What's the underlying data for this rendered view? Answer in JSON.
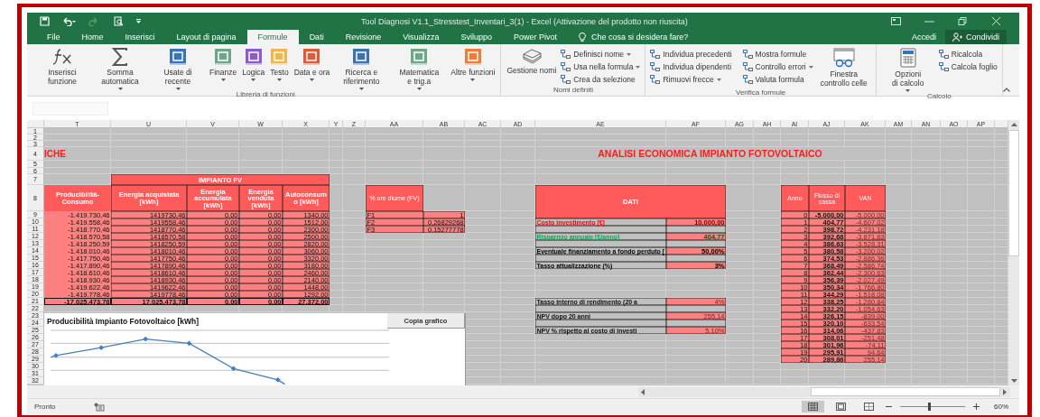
{
  "window": {
    "title": "Tool Diagnosi V1.1_Stresstest_Inventari_3(1) - Excel (Attivazione del prodotto non riuscita)"
  },
  "tabs": [
    {
      "label": "File",
      "selected": false
    },
    {
      "label": "Home",
      "selected": false
    },
    {
      "label": "Inserisci",
      "selected": false
    },
    {
      "label": "Layout di pagina",
      "selected": false
    },
    {
      "label": "Formule",
      "selected": true
    },
    {
      "label": "Dati",
      "selected": false
    },
    {
      "label": "Revisione",
      "selected": false
    },
    {
      "label": "Visualizza",
      "selected": false
    },
    {
      "label": "Sviluppo",
      "selected": false
    },
    {
      "label": "Power Pivot",
      "selected": false
    }
  ],
  "tell_me": {
    "placeholder": "Che cosa si desidera fare?"
  },
  "account": {
    "sign_in": "Accedi",
    "share": "Condividi"
  },
  "ribbon": {
    "groups": [
      {
        "label": "Libreria di funzioni",
        "items": [
          {
            "kind": "big",
            "label": "Inserisci funzione",
            "dropdown": false
          },
          {
            "kind": "big",
            "label": "Somma automatica",
            "dropdown": true
          },
          {
            "kind": "big",
            "label": "Usate di recente",
            "dropdown": true
          },
          {
            "kind": "big",
            "label": "Finanze",
            "dropdown": true
          },
          {
            "kind": "big",
            "label": "Logica",
            "dropdown": true
          },
          {
            "kind": "big",
            "label": "Testo",
            "dropdown": true
          },
          {
            "kind": "big",
            "label": "Data e ora",
            "dropdown": true
          },
          {
            "kind": "big",
            "label": "Ricerca e riferimento",
            "dropdown": true
          },
          {
            "kind": "big",
            "label": "Matematica e trig.a",
            "dropdown": true
          },
          {
            "kind": "big",
            "label": "Altre funzioni",
            "dropdown": true
          }
        ]
      },
      {
        "label": "Nomi definiti",
        "items": [
          {
            "kind": "big",
            "label": "Gestione nomi",
            "dropdown": false
          },
          {
            "kind": "small",
            "label": "Definisci nome",
            "dropdown": true
          },
          {
            "kind": "small",
            "label": "Usa nella formula",
            "dropdown": true
          },
          {
            "kind": "small",
            "label": "Crea da selezione",
            "dropdown": false
          }
        ]
      },
      {
        "label": "Verifica formule",
        "items": [
          {
            "kind": "small",
            "label": "Individua precedenti",
            "dropdown": false
          },
          {
            "kind": "small",
            "label": "Individua dipendenti",
            "dropdown": false
          },
          {
            "kind": "small",
            "label": "Rimuovi frecce",
            "dropdown": true
          },
          {
            "kind": "small",
            "label": "Mostra formule",
            "dropdown": false
          },
          {
            "kind": "small",
            "label": "Controllo errori",
            "dropdown": true
          },
          {
            "kind": "small",
            "label": "Valuta formula",
            "dropdown": false
          },
          {
            "kind": "big",
            "label": "Finestra controllo celle",
            "dropdown": false
          }
        ]
      },
      {
        "label": "Calcolo",
        "items": [
          {
            "kind": "big",
            "label": "Opzioni di calcolo",
            "dropdown": true
          },
          {
            "kind": "small",
            "label": "Ricalcola",
            "dropdown": false
          },
          {
            "kind": "small",
            "label": "Calcola foglio",
            "dropdown": false
          }
        ]
      }
    ]
  },
  "sheet": {
    "columns": [
      "T",
      "U",
      "V",
      "W",
      "X",
      "Y",
      "Z",
      "AA",
      "AB",
      "AC",
      "AD",
      "AE",
      "AF",
      "AG",
      "AH",
      "AI",
      "AJ",
      "AK",
      "AM",
      "AN",
      "AO",
      "AP"
    ],
    "rows": [
      "1",
      "2",
      "3",
      "4",
      "5",
      "6",
      "7",
      "8",
      "9",
      "10",
      "11",
      "12",
      "13",
      "14",
      "15",
      "16",
      "17",
      "18",
      "19",
      "20",
      "21",
      "22",
      "23",
      "24",
      "25",
      "26",
      "27",
      "28",
      "29",
      "30",
      "31",
      "32"
    ],
    "titles": [
      "ICHE",
      "ANALISI ECONOMICA IMPIANTO FOTOVOLTAICO"
    ],
    "energy": {
      "group": "IMPIANTO FV",
      "headers": [
        "Producibilità-Consumo",
        "Energia acquistata [kWh]",
        "Energia accumulata [kWh]",
        "Energia venduta [kWh]",
        "Autoconsumo [kWh]"
      ],
      "rows": [
        [
          "-1.419.730,46",
          "1419730,46",
          "0,00",
          "0,00",
          "1340,00"
        ],
        [
          "-1.419.558,46",
          "1419558,46",
          "0,00",
          "0,00",
          "1512,00"
        ],
        [
          "-1.418.770,46",
          "1418770,46",
          "0,00",
          "0,00",
          "2300,00"
        ],
        [
          "-1.418.570,58",
          "1418570,58",
          "0,00",
          "0,00",
          "2500,00"
        ],
        [
          "-1.418.250,59",
          "1418250,59",
          "0,00",
          "0,00",
          "2820,00"
        ],
        [
          "-1.418.010,46",
          "1418010,46",
          "0,00",
          "0,00",
          "3060,00"
        ],
        [
          "-1.417.750,46",
          "1417750,46",
          "0,00",
          "0,00",
          "3320,00"
        ],
        [
          "-1.417.890,46",
          "1417890,46",
          "0,00",
          "0,00",
          "3180,00"
        ],
        [
          "-1.418.610,46",
          "1418610,46",
          "0,00",
          "0,00",
          "2460,00"
        ],
        [
          "-1.418.930,46",
          "1418930,46",
          "0,00",
          "0,00",
          "2140,00"
        ],
        [
          "-1.419.622,46",
          "1419622,46",
          "0,00",
          "0,00",
          "1448,00"
        ],
        [
          "-1.419.778,46",
          "1419778,46",
          "0,00",
          "0,00",
          "1292,00"
        ]
      ],
      "total": [
        "-17.025.473,78",
        "17.025.473,78",
        "0,00",
        "0,00",
        "27.372,00"
      ]
    },
    "hours": {
      "header": "% ore diurne (FV)",
      "rows": [
        [
          "F1",
          "1"
        ],
        [
          "F2",
          "0,26829268"
        ],
        [
          "F3",
          "0,15277778"
        ]
      ]
    },
    "dati": {
      "header": "DATI",
      "rows": [
        {
          "label": "Costo investimento [€]",
          "value": "10.000,00",
          "color": "#ff0000"
        },
        {
          "label": "Risparmio annuale [€/anno]",
          "value": "404,77",
          "color": "#00b050"
        },
        {
          "label": "Eventuale finanziamento a fondo perduto [",
          "value": "50,00%",
          "color": "#000000"
        },
        {
          "label": "Tasso attualizzazione (%)",
          "value": "3%",
          "color": "#000000"
        }
      ]
    },
    "results": {
      "rows": [
        {
          "label": "Tasso interno di rendimento (20 a",
          "value": "4%"
        },
        {
          "label": "NPV dopo 20 anni",
          "value": "255,14"
        },
        {
          "label": "NPV % rispetto al costo di investi",
          "value": "5,10%"
        }
      ]
    },
    "van": {
      "headers": [
        "Anno",
        "Flusso di cassa",
        "VAN"
      ],
      "rows": [
        [
          "0",
          "-5.000,00",
          "-5.000,00"
        ],
        [
          "1",
          "404,77",
          "-4.607,02"
        ],
        [
          "2",
          "398,72",
          "-4.231,18"
        ],
        [
          "3",
          "392,68",
          "-3.871,83"
        ],
        [
          "4",
          "386,63",
          "-3.528,31"
        ],
        [
          "5",
          "380,58",
          "-3.200,02"
        ],
        [
          "6",
          "374,53",
          "-2.886,36"
        ],
        [
          "7",
          "368,49",
          "-2.586,74"
        ],
        [
          "8",
          "362,44",
          "-2.300,63"
        ],
        [
          "9",
          "356,39",
          "-2.027,49"
        ],
        [
          "10",
          "350,34",
          "-1.766,80"
        ],
        [
          "11",
          "344,29",
          "-1.518,08"
        ],
        [
          "12",
          "338,25",
          "-1.280,84"
        ],
        [
          "13",
          "332,20",
          "-1.054,63"
        ],
        [
          "14",
          "326,15",
          "-839,00"
        ],
        [
          "15",
          "320,10",
          "-633,54"
        ],
        [
          "16",
          "314,06",
          "-437,83"
        ],
        [
          "17",
          "308,01",
          "-251,48"
        ],
        [
          "18",
          "301,96",
          "-74,11"
        ],
        [
          "19",
          "295,91",
          "94,64"
        ],
        [
          "20",
          "289,86",
          "255,14"
        ]
      ]
    }
  },
  "chart": {
    "title": "Producibilità Impianto Fotovoltaico [kWh]",
    "button": "Copia grafico"
  },
  "status_bar": {
    "status": "Pronto",
    "views": [
      {
        "selected": true
      },
      {
        "selected": false
      },
      {
        "selected": false
      }
    ],
    "zoom": {
      "level": 0.45,
      "reading": "60%"
    }
  }
}
